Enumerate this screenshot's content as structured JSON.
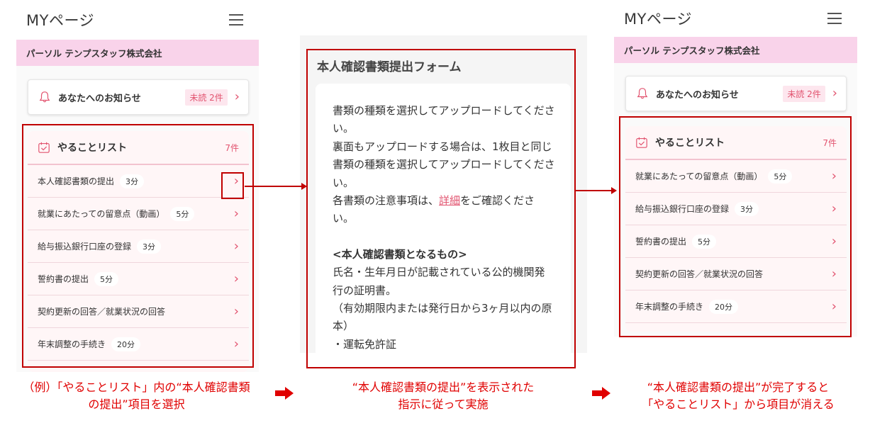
{
  "left_screen": {
    "app_title": "MYページ",
    "company": "パーソル テンプスタッフ株式会社",
    "notice": {
      "label": "あなたへのお知らせ",
      "badge": "未読 2件"
    },
    "todo": {
      "title": "やることリスト",
      "count": "7件",
      "items": [
        {
          "label": "本人確認書類の提出",
          "duration": "3分"
        },
        {
          "label": "就業にあたっての留意点（動画）",
          "duration": "5分"
        },
        {
          "label": "給与振込銀行口座の登録",
          "duration": "3分"
        },
        {
          "label": "誓約書の提出",
          "duration": "5分"
        },
        {
          "label": "契約更新の回答／就業状況の回答",
          "duration": ""
        },
        {
          "label": "年末調整の手続き",
          "duration": "20分"
        }
      ]
    }
  },
  "form": {
    "title": "本人確認書類提出フォーム",
    "para1": "書類の種類を選択してアップロードしてください。",
    "para2": "裏面もアップロードする場合は、1枚目と同じ書類の種類を選択してアップロードしてください。",
    "para3_before": "各書類の注意事項は、",
    "para3_link": "詳細",
    "para3_after": "をご確認ください。",
    "heading": "<本人確認書類となるもの>",
    "para4": "氏名・生年月日が記載されている公的機関発行の証明書。",
    "para5": "（有効期限内または発行日から3ヶ月以内の原本）",
    "bullet1": "・運転免許証"
  },
  "right_screen": {
    "app_title": "MYページ",
    "company": "パーソル テンプスタッフ株式会社",
    "notice": {
      "label": "あなたへのお知らせ",
      "badge": "未読 2件"
    },
    "todo": {
      "title": "やることリスト",
      "count": "7件",
      "items": [
        {
          "label": "就業にあたっての留意点（動画）",
          "duration": "5分"
        },
        {
          "label": "給与振込銀行口座の登録",
          "duration": "3分"
        },
        {
          "label": "誓約書の提出",
          "duration": "5分"
        },
        {
          "label": "契約更新の回答／就業状況の回答",
          "duration": ""
        },
        {
          "label": "年末調整の手続き",
          "duration": "20分"
        }
      ]
    }
  },
  "captions": {
    "step1_line1": "（例）「やることリスト」内の“本人確認書類",
    "step1_line2": "の提出”項目を選択",
    "step2_line1": "“本人確認書類の提出”を表示された",
    "step2_line2": "指示に従って実施",
    "step3_line1": "“本人確認書類の提出”が完了すると",
    "step3_line2": "「やることリスト」から項目が消える"
  },
  "colors": {
    "accent": "#e2536f",
    "highlight": "#c00000",
    "caption": "#e00000",
    "company_bar": "#f9d3ea"
  },
  "icons": {
    "menu": "hamburger-icon",
    "notice": "bell-icon",
    "todo": "calendar-check-icon",
    "row": "chevron-right-icon",
    "step": "right-arrow-icon"
  }
}
